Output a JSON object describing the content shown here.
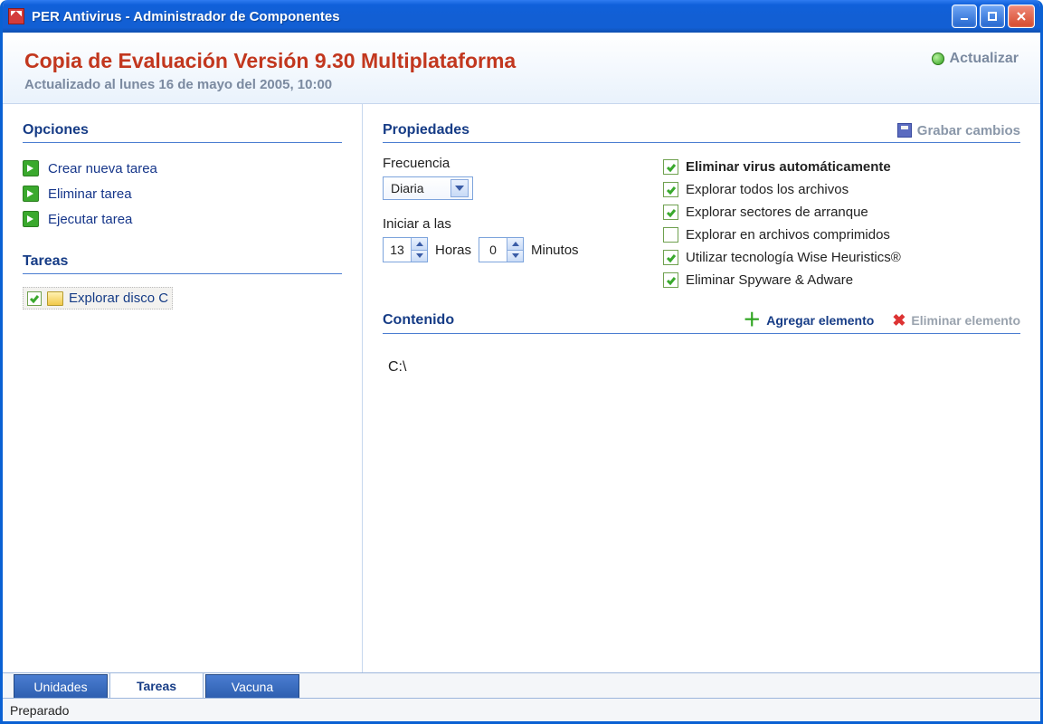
{
  "window": {
    "title": "PER Antivirus - Administrador de Componentes"
  },
  "header": {
    "title": "Copia de Evaluación Versión 9.30 Multiplataforma",
    "updated": "Actualizado al lunes 16 de mayo del 2005, 10:00",
    "actualizar": "Actualizar"
  },
  "sidebar": {
    "options_title": "Opciones",
    "options": [
      {
        "label": "Crear nueva tarea"
      },
      {
        "label": "Eliminar tarea"
      },
      {
        "label": "Ejecutar tarea"
      }
    ],
    "tasks_title": "Tareas",
    "tasks": [
      {
        "label": "Explorar disco C",
        "checked": true
      }
    ]
  },
  "properties": {
    "title": "Propiedades",
    "save_label": "Grabar cambios",
    "frequency_label": "Frecuencia",
    "frequency_value": "Diaria",
    "start_at_label": "Iniciar a las",
    "hours_value": "13",
    "hours_label": "Horas",
    "minutes_value": "0",
    "minutes_label": "Minutos",
    "checks": [
      {
        "label": "Eliminar virus automáticamente",
        "checked": true,
        "bold": true
      },
      {
        "label": "Explorar todos los archivos",
        "checked": true
      },
      {
        "label": "Explorar sectores de arranque",
        "checked": true
      },
      {
        "label": "Explorar en archivos comprimidos",
        "checked": false
      },
      {
        "label": "Utilizar tecnología Wise Heuristics®",
        "checked": true
      },
      {
        "label": "Eliminar Spyware & Adware",
        "checked": true
      }
    ]
  },
  "content": {
    "title": "Contenido",
    "add_label": "Agregar elemento",
    "del_label": "Eliminar elemento",
    "items": [
      "C:\\"
    ]
  },
  "tabs": {
    "items": [
      {
        "label": "Unidades",
        "active": false
      },
      {
        "label": "Tareas",
        "active": true
      },
      {
        "label": "Vacuna",
        "active": false
      }
    ]
  },
  "statusbar": {
    "text": "Preparado"
  }
}
